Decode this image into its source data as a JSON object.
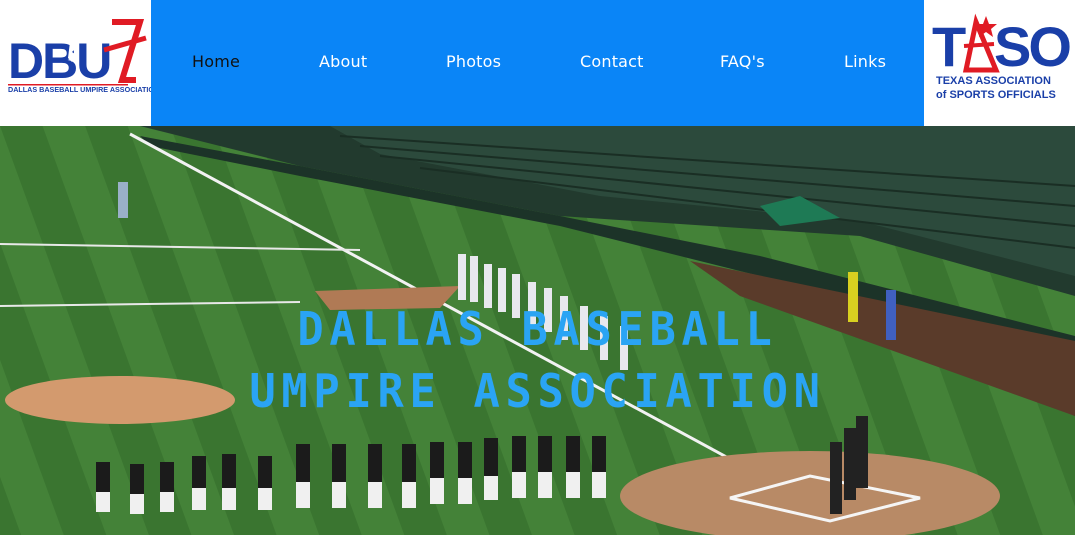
{
  "header": {
    "left_logo": {
      "text": "DBUA",
      "subtitle": "DALLAS BASEBALL UMPIRE ASSOCIATION"
    },
    "nav": [
      {
        "label": "Home",
        "active": true
      },
      {
        "label": "About",
        "active": false
      },
      {
        "label": "Photos",
        "active": false
      },
      {
        "label": "Contact",
        "active": false
      },
      {
        "label": "FAQ's",
        "active": false
      },
      {
        "label": "Links",
        "active": false
      }
    ],
    "right_logo": {
      "text": "TASO",
      "line1": "TEXAS ASSOCIATION",
      "line2": "of SPORTS OFFICIALS"
    }
  },
  "hero": {
    "title_line1": "DALLAS BASEBALL",
    "title_line2": "UMPIRE ASSOCIATION"
  },
  "colors": {
    "nav_bg": "#0a85f7",
    "title": "#2aa4f4",
    "logo_blue": "#1a3fa8",
    "logo_red": "#e01b24"
  }
}
